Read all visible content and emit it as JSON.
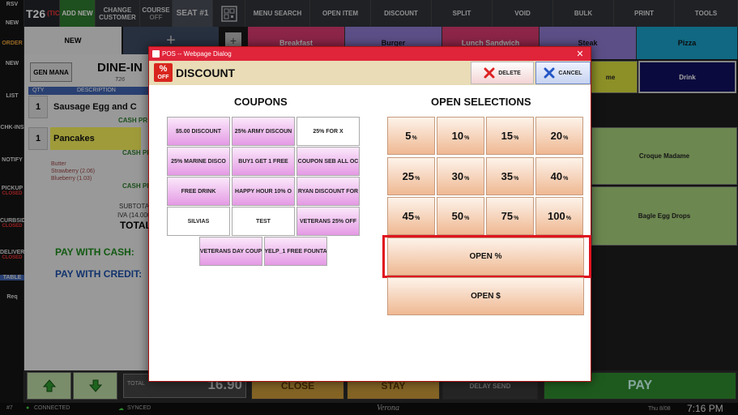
{
  "left_rail": {
    "items": [
      {
        "label": "RSV",
        "sub": ""
      },
      {
        "label": "NEW",
        "sub": ""
      },
      {
        "label": "ORDER",
        "sub": ""
      },
      {
        "label": "NEW",
        "sub": ""
      },
      {
        "label": "LIST",
        "sub": ""
      },
      {
        "label": "CHK-INS",
        "sub": ""
      },
      {
        "label": "NOTIFY",
        "sub": ""
      },
      {
        "label": "PICKUP",
        "sub": "CLOSED"
      },
      {
        "label": "CURBSID",
        "sub": "CLOSED"
      },
      {
        "label": "DELIVER",
        "sub": "CLOSED"
      },
      {
        "label": "TABLE",
        "sub": ""
      },
      {
        "label": "Req",
        "sub": ""
      }
    ]
  },
  "topbar": {
    "ticket": "T26",
    "ticket_suffix": "(TIC",
    "add_new": "ADD NEW",
    "change_customer": "CHANGE CUSTOMER",
    "course": "COURSE",
    "course_sub": "OFF",
    "seat": "SEAT #1",
    "menu_search": "MENU SEARCH",
    "open_item": "OPEN ITEM",
    "discount": "DISCOUNT",
    "split": "SPLIT",
    "void": "VOID",
    "bulk": "BULK",
    "print": "PRINT",
    "tools": "TOOLS"
  },
  "order": {
    "tab_new": "NEW",
    "tab_plus": "+",
    "gen_mana": "GEN MANA",
    "dine_in": "DINE-IN",
    "dine_in_sub": "T26",
    "qty_header": "QTY",
    "desc_header": "DESCRIPTION",
    "lines": [
      {
        "qty": "1",
        "desc": "Sausage Egg and C",
        "price_label": "CASH PR"
      },
      {
        "qty": "1",
        "desc": "Pancakes",
        "price_label": "CASH PR"
      }
    ],
    "modifiers": [
      "Butter",
      "Strawberry (2.06)",
      "Blueberry (1.03)"
    ],
    "mod_price_label": "CASH PR",
    "subtotal": "SUBTOTA",
    "iva": "IVA (14.000%",
    "total": "TOTAL",
    "pay_cash": "PAY WITH CASH:",
    "pay_credit": "PAY WITH CREDIT:"
  },
  "categories": [
    {
      "label": "Breakfast",
      "color": "#d83a6e"
    },
    {
      "label": "Burger",
      "color": "#8e7ad0"
    },
    {
      "label": "Lunch Sandwich",
      "color": "#d83a6e"
    },
    {
      "label": "Steak",
      "color": "#8e7ad0"
    },
    {
      "label": "Pizza",
      "color": "#1aa0c8"
    }
  ],
  "menu_tiles": {
    "right_mid": "me",
    "drink": "Drink",
    "croque": "Croque Madame",
    "bagle": "Bagle Egg Drops"
  },
  "bottom": {
    "total_label": "TOTAL",
    "total_amount": "16.90",
    "close": "CLOSE",
    "stay": "STAY",
    "delay_send": "DELAY SEND",
    "pay": "PAY"
  },
  "status": {
    "station": "#7",
    "connected": "CONNECTED",
    "synced": "SYNCED",
    "brand": "Verona",
    "date": "Thu 8/08",
    "time": "7:16 PM"
  },
  "dialog": {
    "window_title": "POS -- Webpage Dialog",
    "title": "DISCOUNT",
    "icon_text_top": "%",
    "icon_text_bottom": "OFF",
    "delete_label": "DELETE",
    "cancel_label": "CANCEL",
    "coupons_title": "COUPONS",
    "open_title": "OPEN SELECTIONS",
    "coupons": [
      {
        "label": "$5.00 DISCOUNT",
        "style": "pink"
      },
      {
        "label": "25% ARMY DISCOUN",
        "style": "pink"
      },
      {
        "label": "25% FOR X",
        "style": "plain"
      },
      {
        "label": "25% MARINE DISCO",
        "style": "pink"
      },
      {
        "label": "BUY1 GET 1 FREE",
        "style": "pink"
      },
      {
        "label": "COUPON SEB ALL OC",
        "style": "pink"
      },
      {
        "label": "FREE DRINK",
        "style": "pink"
      },
      {
        "label": "HAPPY HOUR 10% O",
        "style": "pink"
      },
      {
        "label": "RYAN DISCOUNT FOR",
        "style": "pink"
      },
      {
        "label": "SILVIAS",
        "style": "plain"
      },
      {
        "label": "TEST",
        "style": "plain"
      },
      {
        "label": "VETERANS 25% OFF",
        "style": "pink"
      },
      {
        "label": "VETERANS DAY COUP",
        "style": "pink"
      },
      {
        "label": "YELP_1 FREE FOUNTA",
        "style": "pink"
      }
    ],
    "percents": [
      {
        "value": "5",
        "unit": "%"
      },
      {
        "value": "10",
        "unit": "%"
      },
      {
        "value": "15",
        "unit": "%"
      },
      {
        "value": "20",
        "unit": "%"
      },
      {
        "value": "25",
        "unit": "%"
      },
      {
        "value": "30",
        "unit": "%"
      },
      {
        "value": "35",
        "unit": "%"
      },
      {
        "value": "40",
        "unit": "%"
      },
      {
        "value": "45",
        "unit": "%"
      },
      {
        "value": "50",
        "unit": "%"
      },
      {
        "value": "75",
        "unit": "%"
      },
      {
        "value": "100",
        "unit": "%"
      }
    ],
    "open_percent": "OPEN %",
    "open_dollar": "OPEN $"
  }
}
